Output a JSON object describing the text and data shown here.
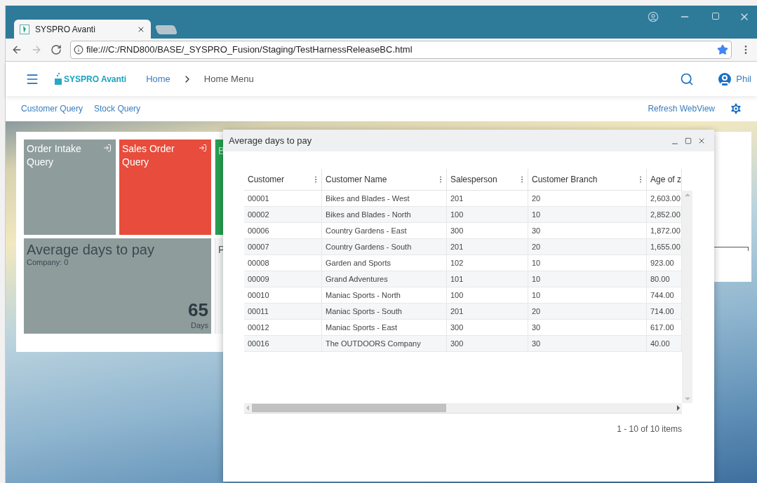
{
  "browser": {
    "tab_title": "SYSPRO Avanti",
    "address": "file:///C:/RND800/BASE/_SYSPRO_Fusion/Staging/TestHarnessReleaseBC.html",
    "bookmarked": true
  },
  "app_header": {
    "logo": "SYSPRO Avanti",
    "breadcrumbs": [
      {
        "label": "Home",
        "selected": false
      },
      {
        "label": "Home Menu",
        "selected": true
      }
    ],
    "user": "Phil"
  },
  "subnav": {
    "links": [
      "Customer Query",
      "Stock Query"
    ],
    "refresh": "Refresh WebView"
  },
  "tiles": [
    {
      "kind": "link",
      "title": "Order Intake Query",
      "color": "#8e9c9c"
    },
    {
      "kind": "link",
      "title": "Sales Order Query",
      "color": "#e74c3c"
    },
    {
      "kind": "partial",
      "title": "B",
      "color": "#27a050"
    },
    {
      "kind": "kpi",
      "title": "Average days to pay",
      "subtitle": "Company: 0",
      "value": "65",
      "unit": "Days",
      "color": "#8e9c9c"
    },
    {
      "kind": "partial",
      "title": "P",
      "color": "#f4f5f5"
    }
  ],
  "dialog": {
    "title": "Average days to pay",
    "columns": [
      "Customer",
      "Customer Name",
      "Salesperson",
      "Customer Branch",
      "Age of z"
    ],
    "rows": [
      [
        "00001",
        "Bikes and Blades - West",
        "201",
        "20",
        "2,603.00"
      ],
      [
        "00002",
        "Bikes and Blades - North",
        "100",
        "10",
        "2,852.00"
      ],
      [
        "00006",
        "Country Gardens - East",
        "300",
        "30",
        "1,872.00"
      ],
      [
        "00007",
        "Country Gardens - South",
        "201",
        "20",
        "1,655.00"
      ],
      [
        "00008",
        "Garden and Sports",
        "102",
        "10",
        "923.00"
      ],
      [
        "00009",
        "Grand Adventures",
        "101",
        "10",
        "80.00"
      ],
      [
        "00010",
        "Maniac Sports - North",
        "100",
        "10",
        "744.00"
      ],
      [
        "00011",
        "Maniac Sports - South",
        "201",
        "20",
        "714.00"
      ],
      [
        "00012",
        "Maniac Sports - East",
        "300",
        "30",
        "617.00"
      ],
      [
        "00016",
        "The OUTDOORS Company",
        "300",
        "30",
        "40.00"
      ]
    ],
    "pager": "1 - 10 of 10 items"
  }
}
